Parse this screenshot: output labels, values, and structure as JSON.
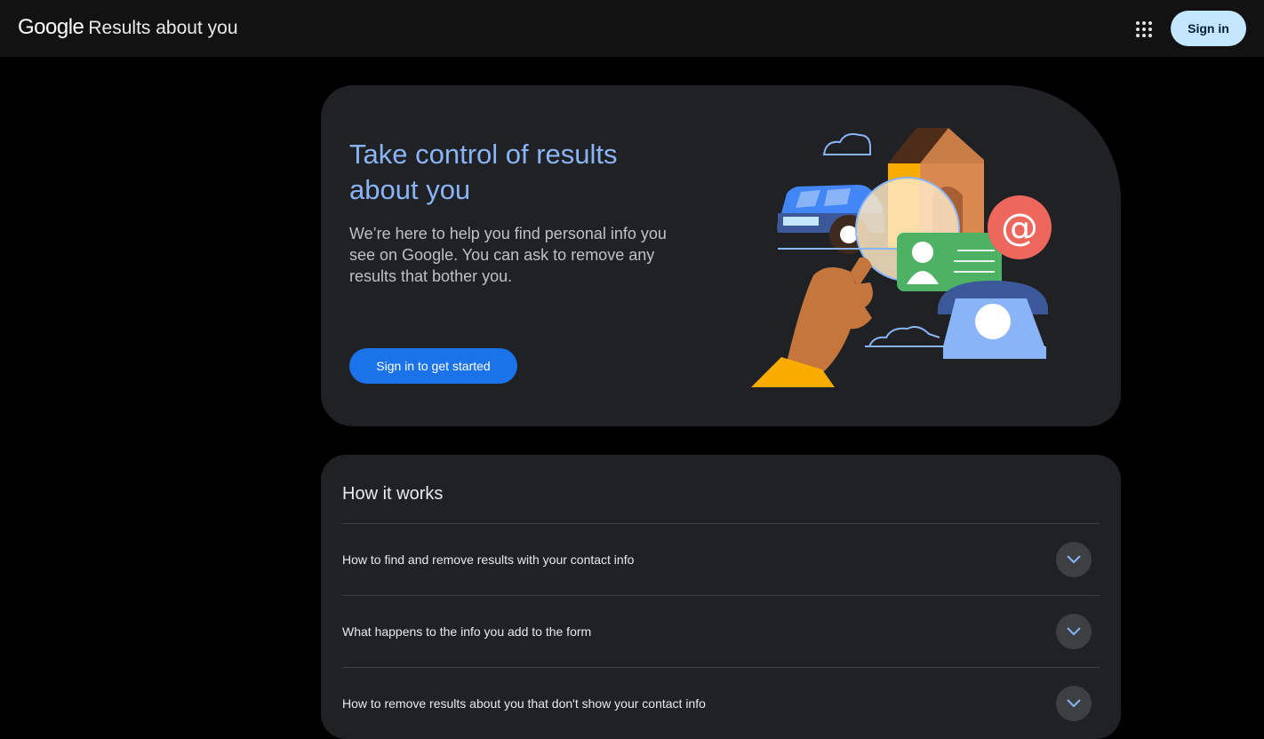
{
  "header": {
    "logo_text": "Google",
    "product_name": "Results about you",
    "apps_icon": "apps-grid-icon",
    "signin_label": "Sign in"
  },
  "hero": {
    "title": "Take control of results about you",
    "description": "We’re here to help you find personal info you see on Google. You can ask to remove any results that bother you.",
    "cta_label": "Sign in to get started",
    "illustration": "personal-info-illustration"
  },
  "how_it_works": {
    "title": "How it works",
    "items": [
      {
        "label": "How to find and remove results with your contact info",
        "icon": "chevron-down-icon"
      },
      {
        "label": "What happens to the info you add to the form",
        "icon": "chevron-down-icon"
      },
      {
        "label": "How to remove results about you that don't show your contact info",
        "icon": "chevron-down-icon"
      }
    ]
  },
  "colors": {
    "page_bg": "#000000",
    "topbar_bg": "#121212",
    "card_bg": "#202124",
    "title_blue": "#8ab4f8",
    "primary_button": "#1a73e8",
    "signin_pill": "#c2e7ff"
  }
}
